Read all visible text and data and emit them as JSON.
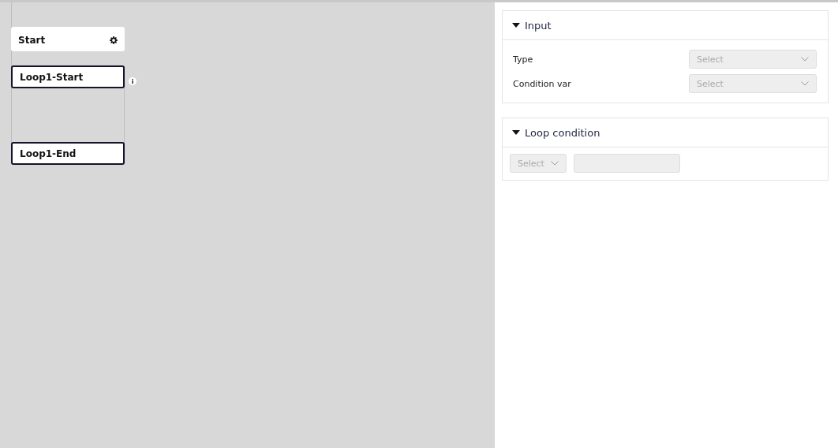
{
  "canvas": {
    "nodes": [
      {
        "label": "Start",
        "kind": "start"
      },
      {
        "label": "Loop1-Start",
        "kind": "loop-start"
      },
      {
        "label": "Loop1-End",
        "kind": "loop-end"
      }
    ]
  },
  "panel": {
    "sections": [
      {
        "title": "Input",
        "expanded": true,
        "kind": "form",
        "fields": [
          {
            "label": "Type",
            "placeholder": "Select",
            "disabled": true
          },
          {
            "label": "Condition var",
            "placeholder": "Select",
            "disabled": true
          }
        ]
      },
      {
        "title": "Loop condition",
        "expanded": true,
        "kind": "condition",
        "select": {
          "placeholder": "Select",
          "disabled": true
        },
        "value_disabled": true
      }
    ]
  }
}
